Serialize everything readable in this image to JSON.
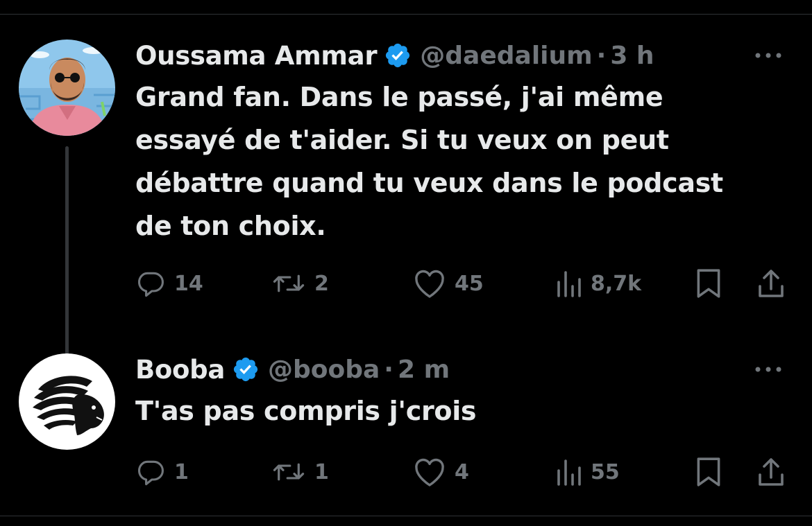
{
  "tweets": [
    {
      "name": "Oussama Ammar",
      "handle": "@daedalium",
      "separator": "·",
      "time": "3 h",
      "text_lines": [
        "Grand fan. Dans le passé, j'ai même",
        "essayé de t'aider. Si tu veux on peut",
        "débattre quand tu veux dans le podcast",
        "de ton choix."
      ],
      "replies": "14",
      "reposts": "2",
      "likes": "45",
      "views": "8,7k"
    },
    {
      "name": "Booba",
      "handle": "@booba",
      "separator": "·",
      "time": "2 m",
      "text_lines": [
        "T'as pas compris j'crois"
      ],
      "replies": "1",
      "reposts": "1",
      "likes": "4",
      "views": "55"
    }
  ],
  "icons": {
    "verified": "verified-badge-icon",
    "more": "more-horizontal-icon",
    "reply": "reply-icon",
    "repost": "repost-icon",
    "like": "heart-icon",
    "views": "views-chart-icon",
    "bookmark": "bookmark-icon",
    "share": "share-icon"
  },
  "colors": {
    "background": "#000000",
    "text": "#e7e9ea",
    "secondary": "#71767b",
    "verified": "#1d9bf0",
    "divider": "#2f3336",
    "thread_line": "#333639"
  }
}
